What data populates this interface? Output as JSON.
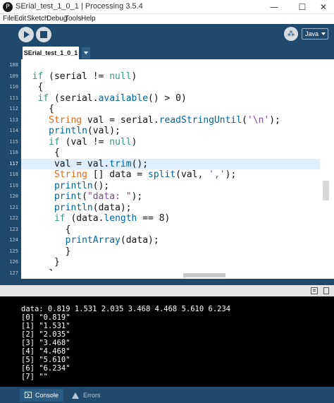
{
  "window": {
    "title": "SErial_test_1_0_1 | Processing 3.5.4",
    "app_icon_glyph": "P",
    "minimize_glyph": "—",
    "maximize_glyph": "☐",
    "close_glyph": "✕"
  },
  "menubar": [
    "File",
    "Edit",
    "Sketch",
    "Debug",
    "Tools",
    "Help"
  ],
  "toolbar": {
    "debug_glyph": "⁂",
    "mode": "Java"
  },
  "tabs": {
    "active_tab": "SErial_test_1_0_1"
  },
  "editor": {
    "current_line_index": 9,
    "lines": [
      {
        "num": "108",
        "indent": "",
        "segments": []
      },
      {
        "num": "109",
        "indent": "  ",
        "segments": [
          {
            "t": "if",
            "c": "kw"
          },
          {
            "t": " (serial != "
          },
          {
            "t": "null",
            "c": "kw"
          },
          {
            "t": ")"
          }
        ]
      },
      {
        "num": "110",
        "indent": "   ",
        "segments": [
          {
            "t": "{"
          }
        ]
      },
      {
        "num": "111",
        "indent": "   ",
        "segments": [
          {
            "t": "if",
            "c": "kw"
          },
          {
            "t": " (serial."
          },
          {
            "t": "available",
            "c": "fn"
          },
          {
            "t": "() > 0)"
          }
        ]
      },
      {
        "num": "112",
        "indent": "     ",
        "segments": [
          {
            "t": "{"
          }
        ]
      },
      {
        "num": "113",
        "indent": "     ",
        "segments": [
          {
            "t": "String",
            "c": "kw2"
          },
          {
            "t": " val = serial."
          },
          {
            "t": "readStringUntil",
            "c": "fn"
          },
          {
            "t": "("
          },
          {
            "t": "'\\n'",
            "c": "str"
          },
          {
            "t": ");"
          }
        ]
      },
      {
        "num": "114",
        "indent": "     ",
        "segments": [
          {
            "t": "println",
            "c": "fn"
          },
          {
            "t": "(val);"
          }
        ]
      },
      {
        "num": "115",
        "indent": "     ",
        "segments": [
          {
            "t": "if",
            "c": "kw"
          },
          {
            "t": " (val != "
          },
          {
            "t": "null",
            "c": "kw"
          },
          {
            "t": ")"
          }
        ]
      },
      {
        "num": "116",
        "indent": "      ",
        "segments": [
          {
            "t": "{"
          }
        ]
      },
      {
        "num": "117",
        "indent": "      ",
        "segments": [
          {
            "t": "val = val."
          },
          {
            "t": "trim",
            "c": "fn"
          },
          {
            "t": "();"
          }
        ]
      },
      {
        "num": "118",
        "indent": "      ",
        "segments": [
          {
            "t": "String",
            "c": "kw2"
          },
          {
            "t": " [] data = "
          },
          {
            "t": "split",
            "c": "fn"
          },
          {
            "t": "(val, "
          },
          {
            "t": "','",
            "c": "str"
          },
          {
            "t": ");"
          }
        ]
      },
      {
        "num": "119",
        "indent": "      ",
        "segments": [
          {
            "t": "println",
            "c": "fn"
          },
          {
            "t": "();"
          }
        ]
      },
      {
        "num": "120",
        "indent": "      ",
        "segments": [
          {
            "t": "print",
            "c": "fn"
          },
          {
            "t": "("
          },
          {
            "t": "\"data: \"",
            "c": "str"
          },
          {
            "t": ");"
          }
        ]
      },
      {
        "num": "121",
        "indent": "      ",
        "segments": [
          {
            "t": "println",
            "c": "fn"
          },
          {
            "t": "(data);"
          }
        ]
      },
      {
        "num": "122",
        "indent": "      ",
        "segments": [
          {
            "t": "if",
            "c": "kw"
          },
          {
            "t": " (data."
          },
          {
            "t": "length",
            "c": "fn"
          },
          {
            "t": " == 8)"
          }
        ]
      },
      {
        "num": "123",
        "indent": "        ",
        "segments": [
          {
            "t": "{"
          }
        ]
      },
      {
        "num": "124",
        "indent": "        ",
        "segments": [
          {
            "t": "printArray",
            "c": "fn"
          },
          {
            "t": "(data);"
          }
        ]
      },
      {
        "num": "125",
        "indent": "        ",
        "segments": [
          {
            "t": "}"
          }
        ]
      },
      {
        "num": "126",
        "indent": "      ",
        "segments": [
          {
            "t": "}"
          }
        ]
      },
      {
        "num": "127",
        "indent": "     ",
        "segments": [
          {
            "t": "}"
          }
        ]
      }
    ]
  },
  "console": {
    "lines": [
      "data: 0.819 1.531 2.035 3.468 4.468 5.610 6.234",
      "[0] \"0.819\"",
      "[1] \"1.531\"",
      "[2] \"2.035\"",
      "[3] \"3.468\"",
      "[4] \"4.468\"",
      "[5] \"5.610\"",
      "[6] \"6.234\"",
      "[7] \"\""
    ]
  },
  "footer": {
    "console_label": "Console",
    "errors_label": "Errors"
  }
}
